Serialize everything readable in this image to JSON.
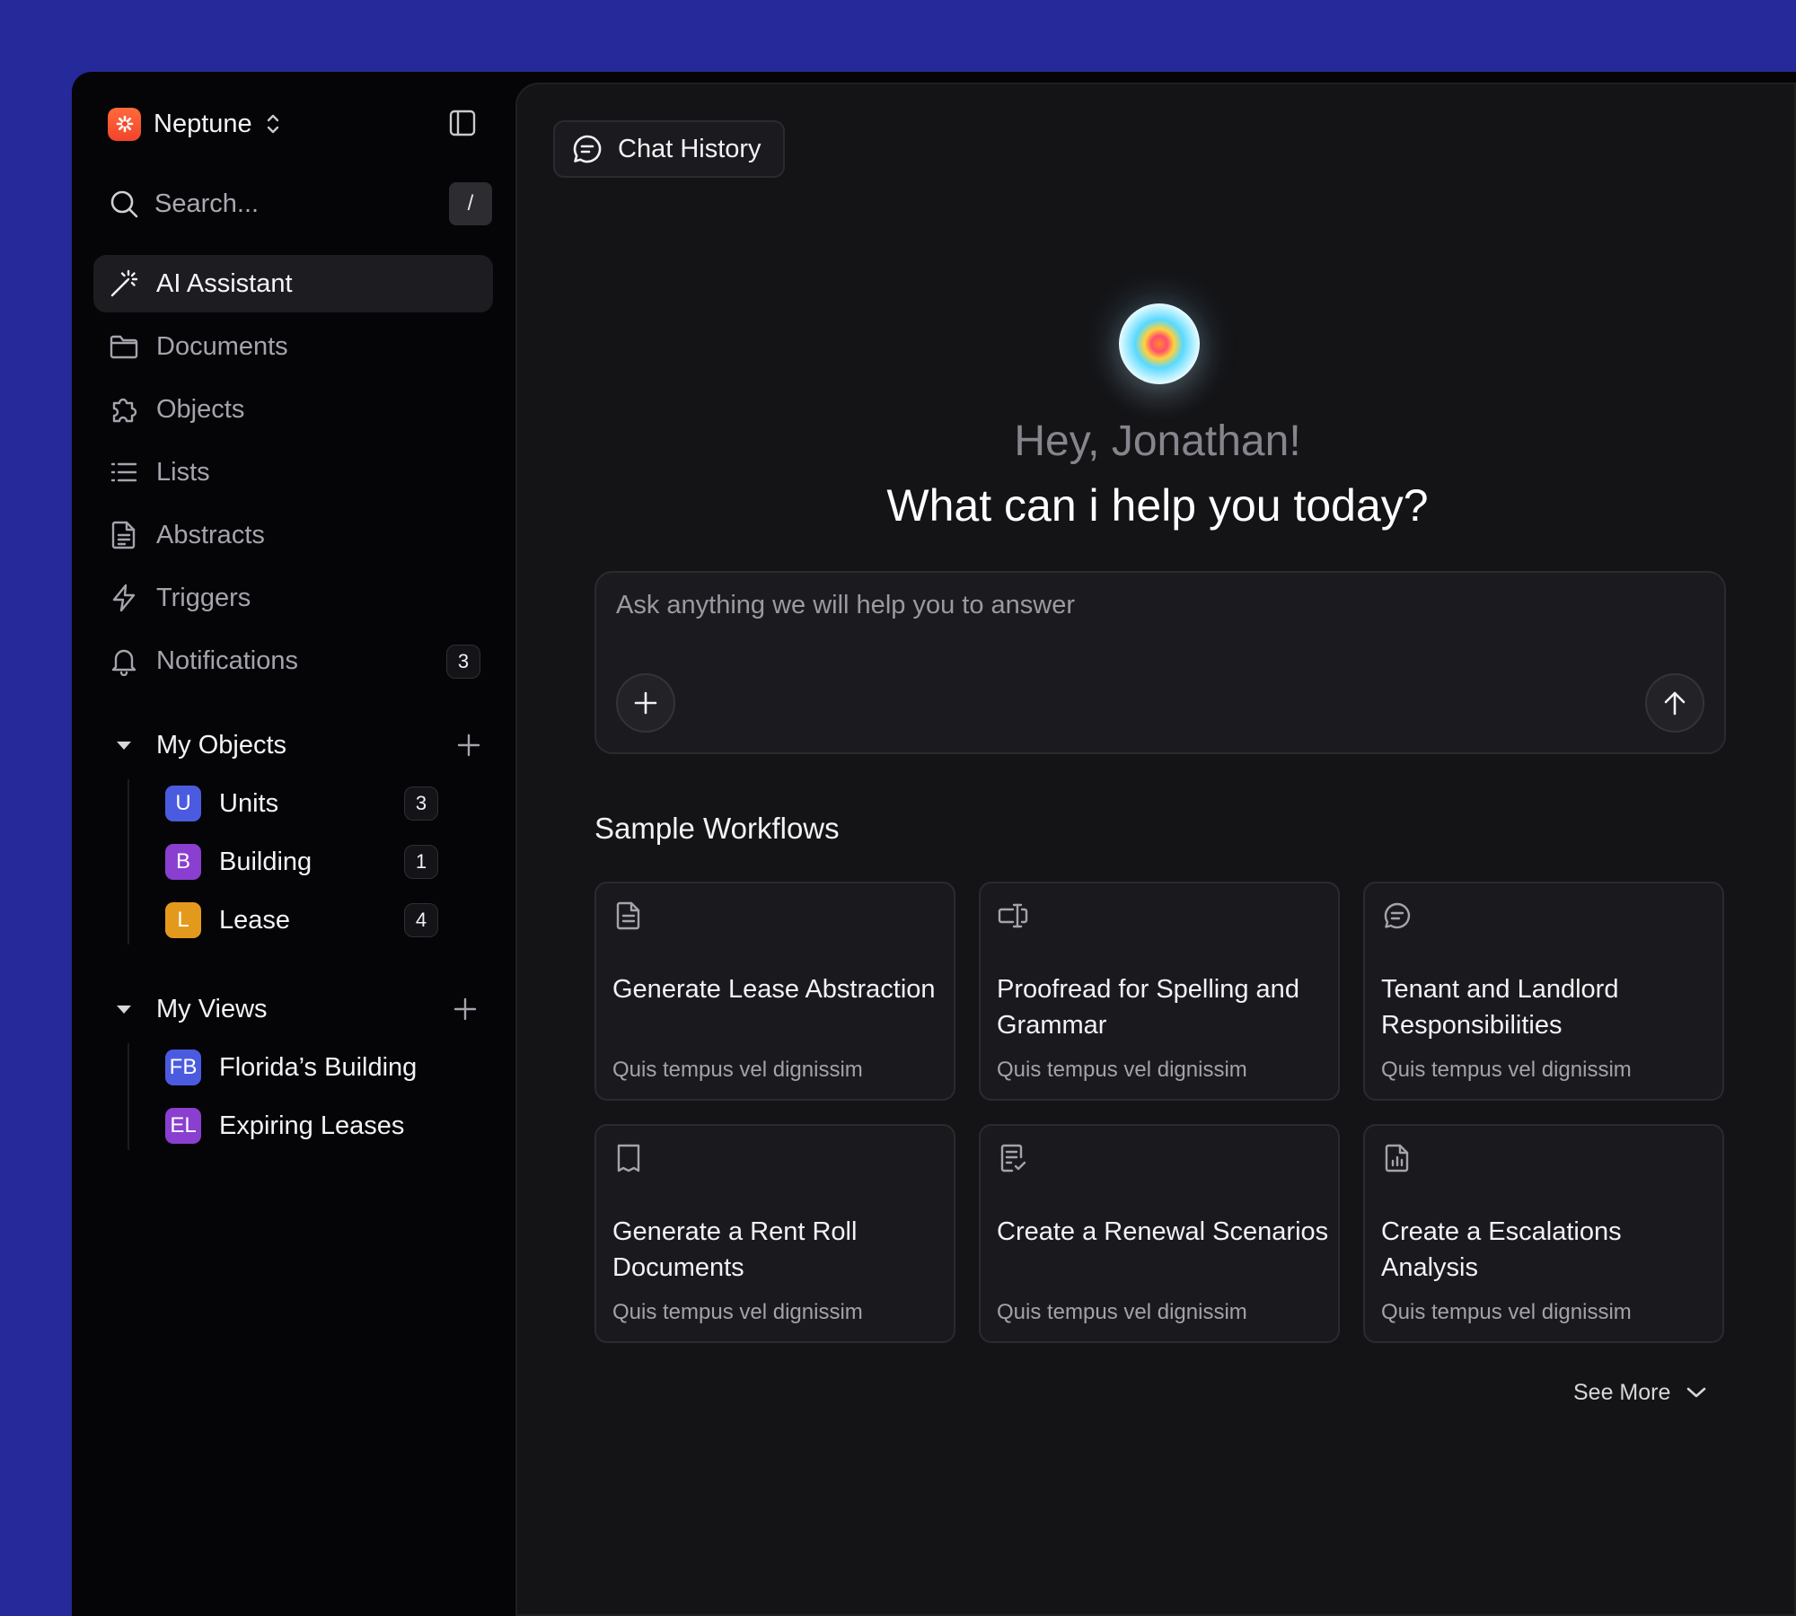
{
  "workspace": {
    "name": "Neptune"
  },
  "search": {
    "placeholder": "Search...",
    "shortcut": "/"
  },
  "nav": [
    {
      "label": "AI Assistant",
      "icon": "magic-wand-icon",
      "active": true
    },
    {
      "label": "Documents",
      "icon": "folder-icon"
    },
    {
      "label": "Objects",
      "icon": "puzzle-icon"
    },
    {
      "label": "Lists",
      "icon": "list-icon"
    },
    {
      "label": "Abstracts",
      "icon": "document-icon"
    },
    {
      "label": "Triggers",
      "icon": "lightning-icon"
    },
    {
      "label": "Notifications",
      "icon": "bell-icon",
      "count": "3"
    }
  ],
  "my_objects": {
    "title": "My Objects",
    "items": [
      {
        "badge": "U",
        "label": "Units",
        "count": "3",
        "color": "#4b5be0"
      },
      {
        "badge": "B",
        "label": "Building",
        "count": "1",
        "color": "#8a3fd0"
      },
      {
        "badge": "L",
        "label": "Lease",
        "count": "4",
        "color": "#e39a1c"
      }
    ]
  },
  "my_views": {
    "title": "My Views",
    "items": [
      {
        "badge": "FB",
        "label": "Florida’s Building",
        "color": "#4b5be0"
      },
      {
        "badge": "EL",
        "label": "Expiring Leases",
        "color": "#8a3fd0"
      }
    ]
  },
  "main": {
    "chat_history_label": "Chat History",
    "greeting": "Hey, Jonathan!",
    "headline": "What can i help you today?",
    "composer_placeholder": "Ask anything we will help you to answer",
    "workflows_title": "Sample Workflows",
    "workflows": [
      {
        "title": "Generate Lease Abstraction",
        "subtitle": "Quis tempus vel dignissim",
        "icon": "document-icon"
      },
      {
        "title": "Proofread for Spelling and Grammar",
        "subtitle": "Quis tempus vel dignissim",
        "icon": "text-cursor-icon"
      },
      {
        "title": "Tenant and Landlord Responsibilities",
        "subtitle": "Quis tempus vel dignissim",
        "icon": "chat-icon"
      },
      {
        "title": "Generate a Rent Roll Documents",
        "subtitle": "Quis tempus vel dignissim",
        "icon": "receipt-icon"
      },
      {
        "title": "Create a Renewal Scenarios",
        "subtitle": "Quis tempus vel dignissim",
        "icon": "checklist-icon"
      },
      {
        "title": "Create a Escalations Analysis",
        "subtitle": "Quis tempus vel dignissim",
        "icon": "chart-file-icon"
      }
    ],
    "see_more_label": "See More"
  },
  "colors": {
    "background": "#25299a",
    "app": "#050507",
    "panel": "#141417",
    "accent": "#f2452a"
  }
}
